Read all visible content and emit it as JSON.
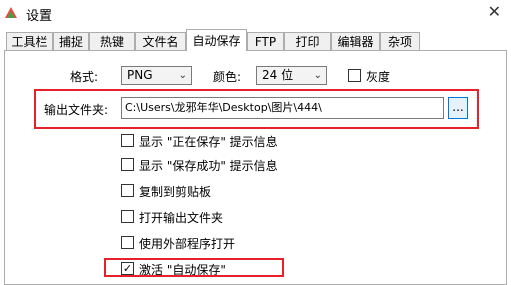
{
  "window": {
    "title": "设置",
    "close_glyph": "✕"
  },
  "tabs": [
    {
      "label": "工具栏"
    },
    {
      "label": "捕捉"
    },
    {
      "label": "热键"
    },
    {
      "label": "文件名"
    },
    {
      "label": "自动保存",
      "active": true
    },
    {
      "label": "FTP"
    },
    {
      "label": "打印"
    },
    {
      "label": "编辑器"
    },
    {
      "label": "杂项"
    }
  ],
  "format": {
    "label": "格式:",
    "value": "PNG",
    "color_label": "颜色:",
    "color_value": "24 位",
    "gray_label": "灰度",
    "gray_checked": false
  },
  "output": {
    "label": "输出文件夹:",
    "path": "C:\\Users\\龙邪年华\\Desktop\\图片\\444\\",
    "browse_label": "..."
  },
  "options": [
    {
      "label": "显示 \"正在保存\" 提示信息",
      "checked": false
    },
    {
      "label": "显示 \"保存成功\" 提示信息",
      "checked": false
    },
    {
      "label": "复制到剪贴板",
      "checked": false
    },
    {
      "label": "打开输出文件夹",
      "checked": false
    },
    {
      "label": "使用外部程序打开",
      "checked": false
    },
    {
      "label": "激活 \"自动保存\"",
      "checked": true
    }
  ],
  "icons": {
    "app": "picpick-app-icon",
    "dropdown": "chevron-down-icon",
    "check": "✓"
  },
  "colors": {
    "highlight": "#e8202a",
    "accent": "#0078d7"
  }
}
